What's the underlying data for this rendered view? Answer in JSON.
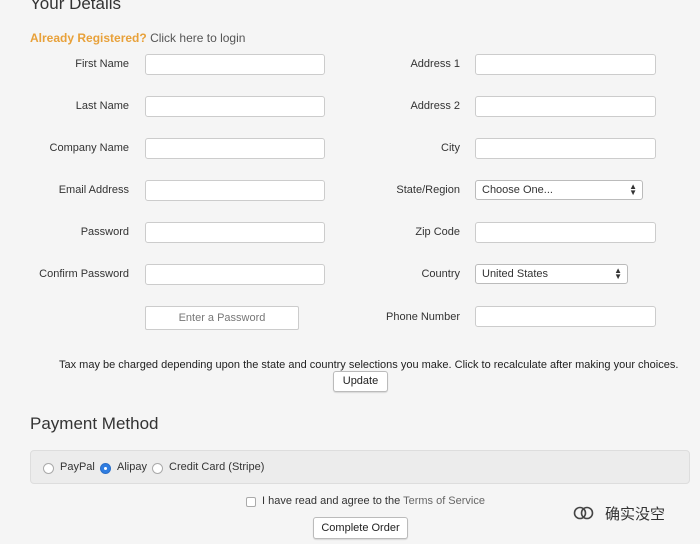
{
  "page": {
    "title": "Your Details",
    "already_registered": "Already Registered?",
    "login_link": "Click here to login"
  },
  "left_fields": [
    {
      "label": "First Name",
      "value": ""
    },
    {
      "label": "Last Name",
      "value": ""
    },
    {
      "label": "Company Name",
      "value": ""
    },
    {
      "label": "Email Address",
      "value": ""
    },
    {
      "label": "Password",
      "value": ""
    },
    {
      "label": "Confirm Password",
      "value": ""
    }
  ],
  "password_button": "Enter a Password",
  "right_fields": {
    "address1": {
      "label": "Address 1",
      "value": ""
    },
    "address2": {
      "label": "Address 2",
      "value": ""
    },
    "city": {
      "label": "City",
      "value": ""
    },
    "state": {
      "label": "State/Region",
      "selected": "Choose One..."
    },
    "zip": {
      "label": "Zip Code",
      "value": ""
    },
    "country": {
      "label": "Country",
      "selected": "United States"
    },
    "phone": {
      "label": "Phone Number",
      "value": ""
    }
  },
  "tax": {
    "notice": "Tax may be charged depending upon the state and country selections you make. Click to recalculate after making your choices.",
    "update_label": "Update"
  },
  "payment": {
    "title": "Payment Method",
    "options": [
      {
        "label": "PayPal",
        "selected": false
      },
      {
        "label": "Alipay",
        "selected": true
      },
      {
        "label": "Credit Card (Stripe)",
        "selected": false
      }
    ]
  },
  "agreement": {
    "text": "I have read and agree to the",
    "tos_link": "Terms of Service",
    "checked": false
  },
  "complete_order_label": "Complete Order",
  "watermark": {
    "icon": "wechat-icon",
    "text": "确实没空"
  }
}
